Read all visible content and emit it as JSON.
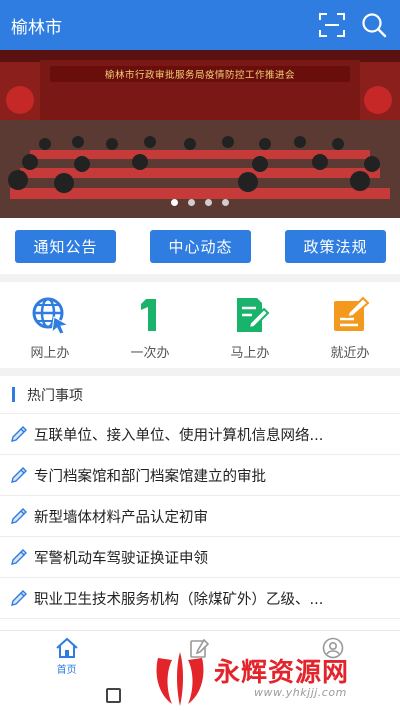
{
  "header": {
    "title": "榆林市",
    "scan_icon": "scan-icon",
    "search_icon": "search-icon"
  },
  "banner": {
    "caption": "榆林市行政审批服务局疫情防控工作推进会",
    "dots": 4,
    "active_dot": 0
  },
  "tabs": [
    {
      "label": "通知公告"
    },
    {
      "label": "中心动态"
    },
    {
      "label": "政策法规"
    }
  ],
  "accent": "#2f7de1",
  "services": [
    {
      "label": "网上办",
      "icon": "globe-cursor-icon",
      "color": "#2f7de1"
    },
    {
      "label": "一次办",
      "icon": "number-one-icon",
      "color": "#19b36b"
    },
    {
      "label": "马上办",
      "icon": "document-pen-icon",
      "color": "#19b36b"
    },
    {
      "label": "就近办",
      "icon": "notepad-pen-icon",
      "color": "#f39a1e"
    }
  ],
  "hot": {
    "title": "热门事项",
    "items": [
      {
        "text": "互联单位、接入单位、使用计算机信息网络..."
      },
      {
        "text": "专门档案馆和部门档案馆建立的审批"
      },
      {
        "text": "新型墙体材料产品认定初审"
      },
      {
        "text": "军警机动车驾驶证换证申领"
      },
      {
        "text": "职业卫生技术服务机构（除煤矿外）乙级、..."
      }
    ]
  },
  "nav": [
    {
      "label": "首页",
      "icon": "home-icon",
      "active": true
    },
    {
      "label": "",
      "icon": "edit-icon",
      "active": false
    },
    {
      "label": "",
      "icon": "user-icon",
      "active": false
    }
  ],
  "watermark": {
    "name": "永辉资源网",
    "url": "www.yhkjjj.com"
  }
}
